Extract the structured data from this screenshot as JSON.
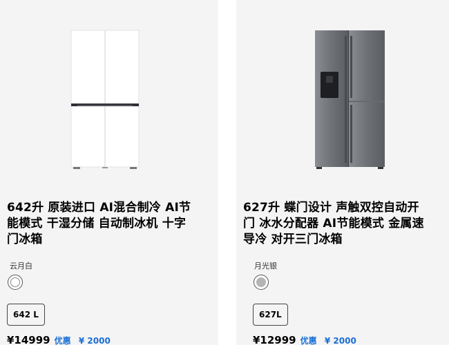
{
  "products": [
    {
      "title_lines": [
        "642升 原装进口 AI混合制冷 AI节",
        "能模式 干湿分储 自动制冰机 十字",
        "门冰箱"
      ],
      "color_label": "云月白",
      "swatch_color": "#ffffff",
      "capacity": "642 L",
      "price": "¥14999",
      "promo_label": "优惠",
      "promo_amount": "¥ 2000"
    },
    {
      "title_lines": [
        "627升 蝶门设计 声触双控自动开",
        "门 冰水分配器 AI节能模式 金属速",
        "导冷 对开三门冰箱"
      ],
      "color_label": "月光银",
      "swatch_color": "#b4b4b4",
      "capacity": "627L",
      "price": "¥12999",
      "promo_label": "优惠",
      "promo_amount": "¥ 2000"
    }
  ]
}
